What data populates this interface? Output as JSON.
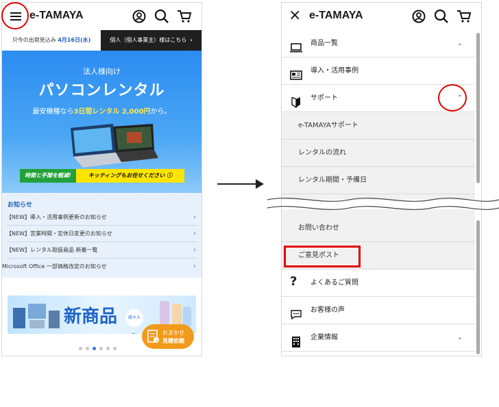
{
  "left_screen": {
    "logo": "e-TAMAYA",
    "icons": [
      "hamburger-menu-icon",
      "account-icon",
      "search-icon",
      "cart-icon"
    ],
    "subbar": {
      "shipping_prefix": "只今の出荷見込み",
      "shipping_date": "4月16日(水)",
      "business_link": "個人（個人事業主）様はこちら",
      "business_arrow": "›"
    },
    "hero": {
      "kicker": "法人様向け",
      "title": "パソコンレンタル",
      "tagline_prefix": "最安機種なら",
      "tagline_highlight": "3日間レンタル 2,000円",
      "tagline_suffix": "から。",
      "ribbon_left": "時間と手間を軽減!",
      "ribbon_right": "キッティングもお任せください ⓘ"
    },
    "news": {
      "heading": "お知らせ",
      "items": [
        "【NEW】導入・活用事例更新のお知らせ",
        "【NEW】営業時間・定休日変更のお知らせ",
        "【NEW】レンタル取扱商品 新着一覧",
        "Microsoft Office 一部価格改定のお知らせ"
      ],
      "arrow": "›"
    },
    "banner": {
      "headline": "新商品",
      "badge": "続々入荷!"
    },
    "carousel": {
      "count": 6,
      "active_index": 2
    },
    "fab": {
      "line1": "おまかせ",
      "line2": "見積依頼"
    }
  },
  "right_screen": {
    "logo": "e-TAMAYA",
    "close": "×",
    "menu_items_top": [
      {
        "label": "商品一覧",
        "icon": "laptop-icon",
        "chevron": "⌄"
      },
      {
        "label": "導入・活用事例",
        "icon": "newspaper-icon",
        "chevron": ""
      },
      {
        "label": "サポート",
        "icon": "beginner-mark-icon",
        "chevron": "⌃"
      }
    ],
    "support_submenu": [
      "e-TAMAYAサポート",
      "レンタルの流れ",
      "レンタル期間・予備日"
    ],
    "support_submenu_after_break": [
      "お問い合わせ",
      "ご意見ポスト"
    ],
    "menu_items_bottom": [
      {
        "label": "よくあるご質問",
        "icon": "question-icon",
        "chevron": ""
      },
      {
        "label": "お客様の声",
        "icon": "speech-bubble-icon",
        "chevron": ""
      },
      {
        "label": "企業情報",
        "icon": "building-icon",
        "chevron": "⌄"
      }
    ]
  },
  "colors": {
    "highlight_red": "#e30000",
    "brand_blue": "#1d5fc0",
    "dark_bar": "#1f1f1f"
  }
}
